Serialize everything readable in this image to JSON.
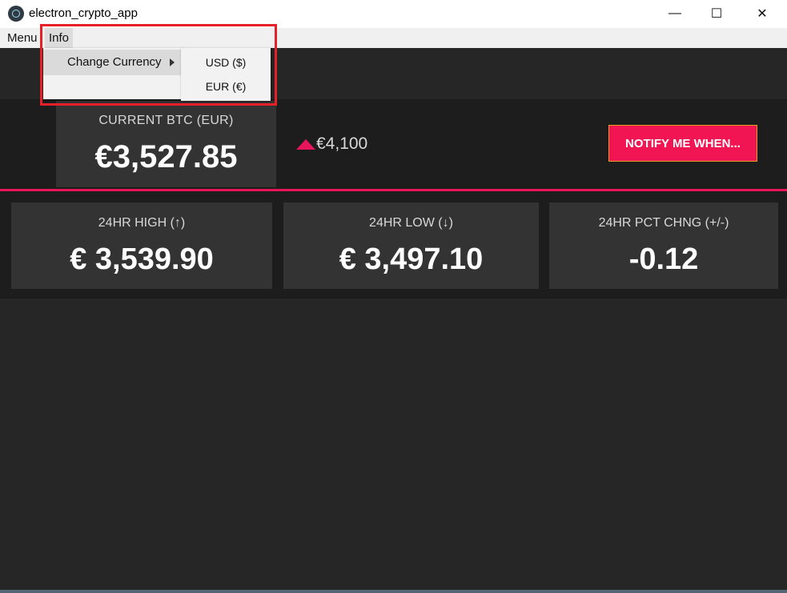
{
  "window": {
    "title": "electron_crypto_app",
    "minimize": "—",
    "maximize": "☐",
    "close": "✕"
  },
  "menubar": {
    "items": [
      "Menu",
      "Info"
    ]
  },
  "info_menu": {
    "items": [
      {
        "label": "Change Currency",
        "has_submenu": true
      }
    ],
    "submenu": [
      "USD ($)",
      "EUR (€)"
    ]
  },
  "current": {
    "label": "CURRENT BTC (EUR)",
    "value": "€3,527.85"
  },
  "target": {
    "value": "€4,100"
  },
  "notify_button": "NOTIFY ME WHEN...",
  "stats": [
    {
      "label": "24HR HIGH (↑)",
      "value": "€ 3,539.90"
    },
    {
      "label": "24HR LOW (↓)",
      "value": "€ 3,497.10"
    },
    {
      "label": "24HR PCT CHNG (+/-)",
      "value": "-0.12"
    }
  ],
  "colors": {
    "accent": "#e8155a",
    "button": "#f11653",
    "highlight": "#e52028",
    "background": "#262626",
    "card": "#333333"
  }
}
